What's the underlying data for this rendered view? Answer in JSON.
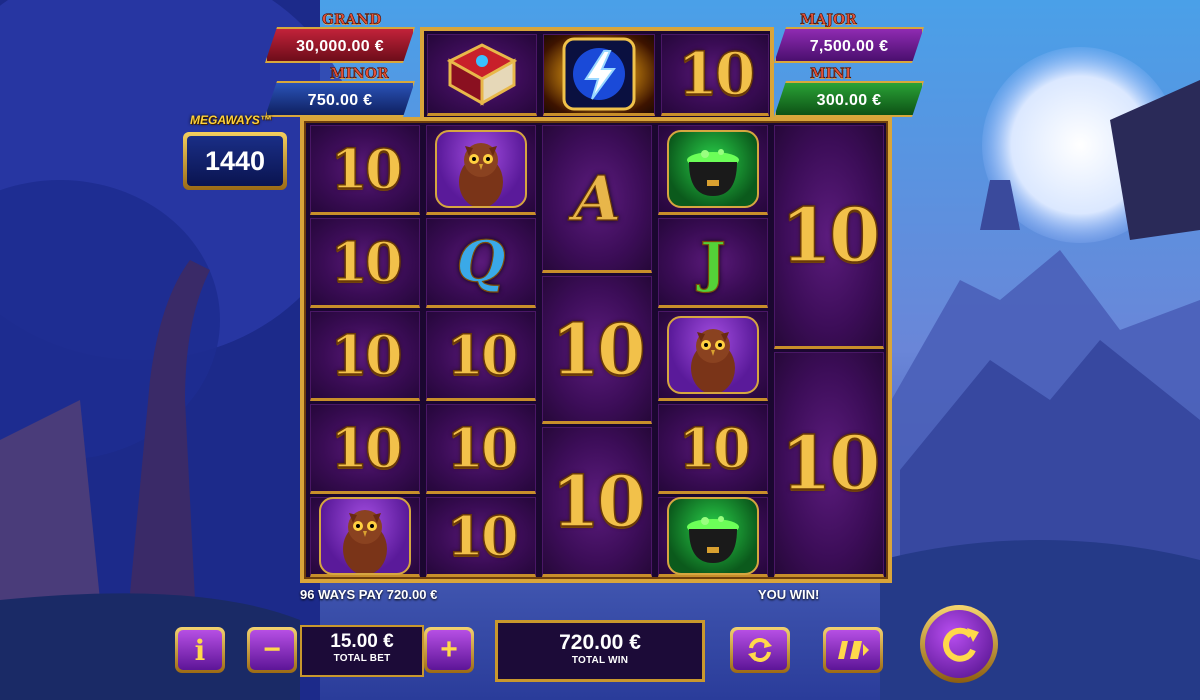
{
  "jackpots": {
    "grand": {
      "title": "GRAND",
      "value": "30,000.00 €"
    },
    "major": {
      "title": "MAJOR",
      "value": "7,500.00 €"
    },
    "minor": {
      "title": "MINOR",
      "value": "750.00 €"
    },
    "mini": {
      "title": "MINI",
      "value": "300.00 €"
    }
  },
  "megaways": {
    "logo": "MEGAWAYS™",
    "count": "1440"
  },
  "top_reel": [
    "spellbook",
    "lightning",
    "10"
  ],
  "reels": {
    "col1": [
      "10",
      "10",
      "10",
      "10",
      "owl"
    ],
    "col2": [
      "owl",
      "Q",
      "10",
      "10",
      "10"
    ],
    "col3": [
      "A",
      "10",
      "10"
    ],
    "col4": [
      "cauldron",
      "J",
      "owl",
      "10",
      "cauldron"
    ],
    "col5": [
      "10",
      "10"
    ]
  },
  "win_line": "96 WAYS PAY 720.00 €",
  "you_win": "YOU WIN!",
  "bet": {
    "value": "15.00 €",
    "label": "TOTAL BET"
  },
  "win": {
    "value": "720.00 €",
    "label": "TOTAL WIN"
  },
  "buttons": {
    "info": "i",
    "minus": "−",
    "plus": "+"
  },
  "icons": {
    "info": "info-icon",
    "minus": "minus-icon",
    "plus": "plus-icon",
    "autoplay": "autoplay-icon",
    "turbo": "turbo-icon",
    "spin": "spin-icon"
  }
}
